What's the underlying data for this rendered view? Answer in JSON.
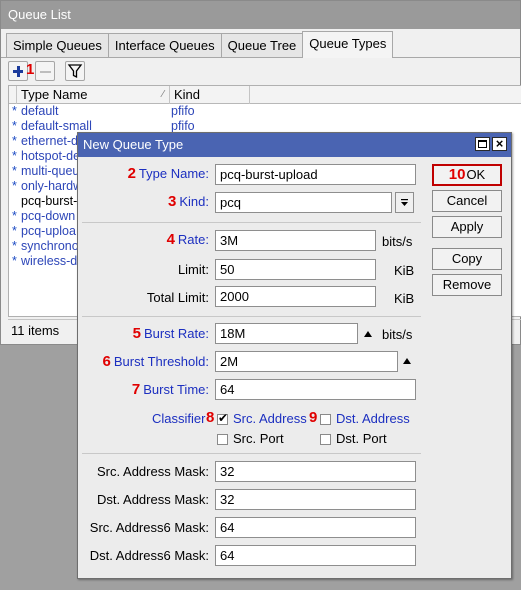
{
  "queue_window": {
    "title": "Queue List",
    "tabs": [
      "Simple Queues",
      "Interface Queues",
      "Queue Tree",
      "Queue Types"
    ],
    "toolbar": {
      "add_icon": "plus-icon",
      "remove_icon": "minus-icon",
      "filter_icon": "filter-icon",
      "annotation": "1"
    },
    "columns": {
      "name": "Type Name",
      "kind": "Kind"
    },
    "rows": [
      {
        "star": "*",
        "name": "default",
        "kind": "pfifo"
      },
      {
        "star": "*",
        "name": "default-small",
        "kind": "pfifo"
      },
      {
        "star": "*",
        "name": "ethernet-d",
        "kind": ""
      },
      {
        "star": "*",
        "name": "hotspot-de",
        "kind": ""
      },
      {
        "star": "*",
        "name": "multi-queu",
        "kind": ""
      },
      {
        "star": "*",
        "name": "only-hardw",
        "kind": ""
      },
      {
        "star": "",
        "name": "pcq-burst-",
        "kind": ""
      },
      {
        "star": "*",
        "name": "pcq-down",
        "kind": ""
      },
      {
        "star": "*",
        "name": "pcq-uploa",
        "kind": ""
      },
      {
        "star": "*",
        "name": "synchrono",
        "kind": ""
      },
      {
        "star": "*",
        "name": "wireless-d",
        "kind": ""
      }
    ],
    "status": {
      "count": "11 items"
    }
  },
  "dialog": {
    "title": "New Queue Type",
    "fields": {
      "type_name": {
        "num": "2",
        "label": "Type Name:",
        "value": "pcq-burst-upload"
      },
      "kind": {
        "num": "3",
        "label": "Kind:",
        "value": "pcq"
      },
      "rate": {
        "num": "4",
        "label": "Rate:",
        "value": "3M",
        "unit": "bits/s"
      },
      "limit": {
        "label": "Limit:",
        "value": "50",
        "unit": "KiB"
      },
      "total_limit": {
        "label": "Total Limit:",
        "value": "2000",
        "unit": "KiB"
      },
      "burst_rate": {
        "num": "5",
        "label": "Burst Rate:",
        "value": "18M",
        "unit": "bits/s"
      },
      "burst_threshold": {
        "num": "6",
        "label": "Burst Threshold:",
        "value": "2M"
      },
      "burst_time": {
        "num": "7",
        "label": "Burst Time:",
        "value": "64"
      },
      "src_mask": {
        "label": "Src. Address Mask:",
        "value": "32"
      },
      "dst_mask": {
        "label": "Dst. Address Mask:",
        "value": "32"
      },
      "src6_mask": {
        "label": "Src. Address6 Mask:",
        "value": "64"
      },
      "dst6_mask": {
        "label": "Dst. Address6 Mask:",
        "value": "64"
      }
    },
    "classifier": {
      "label": "Classifier",
      "num_src": "8",
      "num_dst": "9",
      "options": [
        {
          "label": "Src. Address",
          "checked": true
        },
        {
          "label": "Dst. Address",
          "checked": false
        },
        {
          "label": "Src. Port",
          "checked": false
        },
        {
          "label": "Dst. Port",
          "checked": false
        }
      ]
    },
    "buttons": {
      "ok_num": "10",
      "ok": "OK",
      "cancel": "Cancel",
      "apply": "Apply",
      "copy": "Copy",
      "remove": "Remove"
    }
  },
  "colors": {
    "dialog_title_bg": "#4a64b2",
    "annotation_red": "#e00000",
    "label_blue": "#1c2fc0"
  }
}
